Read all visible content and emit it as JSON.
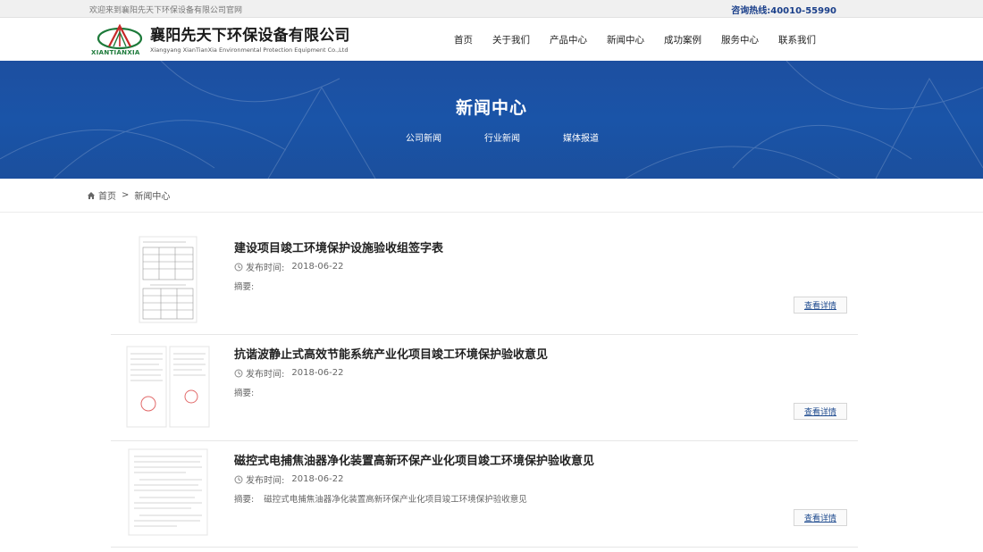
{
  "topbar": {
    "welcome": "欢迎来到襄阳先天下环保设备有限公司官网",
    "hotline": "咨询热线:40010-55990"
  },
  "logo": {
    "en_mark": "XIANTIANXIA",
    "company_cn": "襄阳先天下环保设备有限公司",
    "company_en": "Xiangyang XianTianXia Environmental Protection Equipment Co.,Ltd"
  },
  "nav": [
    "首页",
    "关于我们",
    "产品中心",
    "新闻中心",
    "成功案例",
    "服务中心",
    "联系我们"
  ],
  "banner": {
    "title": "新闻中心",
    "subnav": [
      "公司新闻",
      "行业新闻",
      "媒体报道"
    ]
  },
  "breadcrumb": {
    "home": "首页",
    "separator": ">",
    "current": "新闻中心"
  },
  "news": [
    {
      "title": "建设项目竣工环境保护设施验收组签字表",
      "date_label": "发布时间:",
      "date": "2018-06-22",
      "abstract_label": "摘要:",
      "abstract": "",
      "more": "查看详情"
    },
    {
      "title": "抗谐波静止式高效节能系统产业化项目竣工环境保护验收意见",
      "date_label": "发布时间:",
      "date": "2018-06-22",
      "abstract_label": "摘要:",
      "abstract": "",
      "more": "查看详情"
    },
    {
      "title": "磁控式电捕焦油器净化装置高新环保产业化项目竣工环境保护验收意见",
      "date_label": "发布时间:",
      "date": "2018-06-22",
      "abstract_label": "摘要:",
      "abstract": "磁控式电捕焦油器净化装置高新环保产业化项目竣工环境保护验收意见",
      "more": "查看详情"
    }
  ],
  "colors": {
    "banner_blue": "#1a54a8",
    "hotline_blue": "#1a3f8a",
    "logo_green": "#1d7a3a",
    "logo_red": "#c62828"
  }
}
